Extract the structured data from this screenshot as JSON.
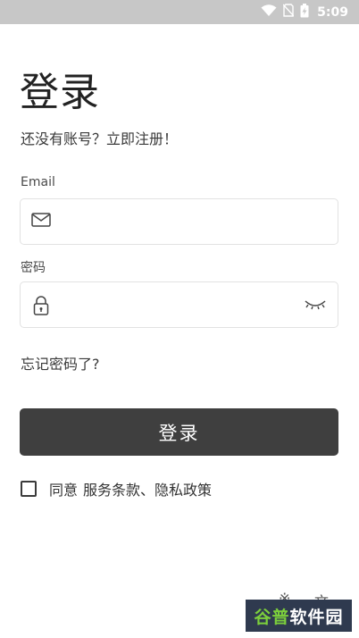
{
  "status_bar": {
    "time": "5:09",
    "icons": [
      "wifi-icon",
      "no-sim-icon",
      "battery-charging-icon"
    ]
  },
  "page": {
    "title": "登录",
    "subtitle": "还没有账号？立即注册！"
  },
  "email_field": {
    "label": "Email",
    "value": "",
    "placeholder": "",
    "icon": "mail-icon"
  },
  "password_field": {
    "label": "密码",
    "value": "",
    "placeholder": "",
    "icon": "lock-icon",
    "toggle_icon": "eye-closed-icon"
  },
  "forgot_password": "忘记密码了?",
  "login_button": "登录",
  "agreement": {
    "checked": false,
    "agree_text": "同意",
    "terms_text": "服务条款、隐私政策"
  },
  "bottom_symbols": {
    "left": "※",
    "right": "文"
  },
  "watermark": {
    "part1": "谷普",
    "part2": "软件园"
  }
}
